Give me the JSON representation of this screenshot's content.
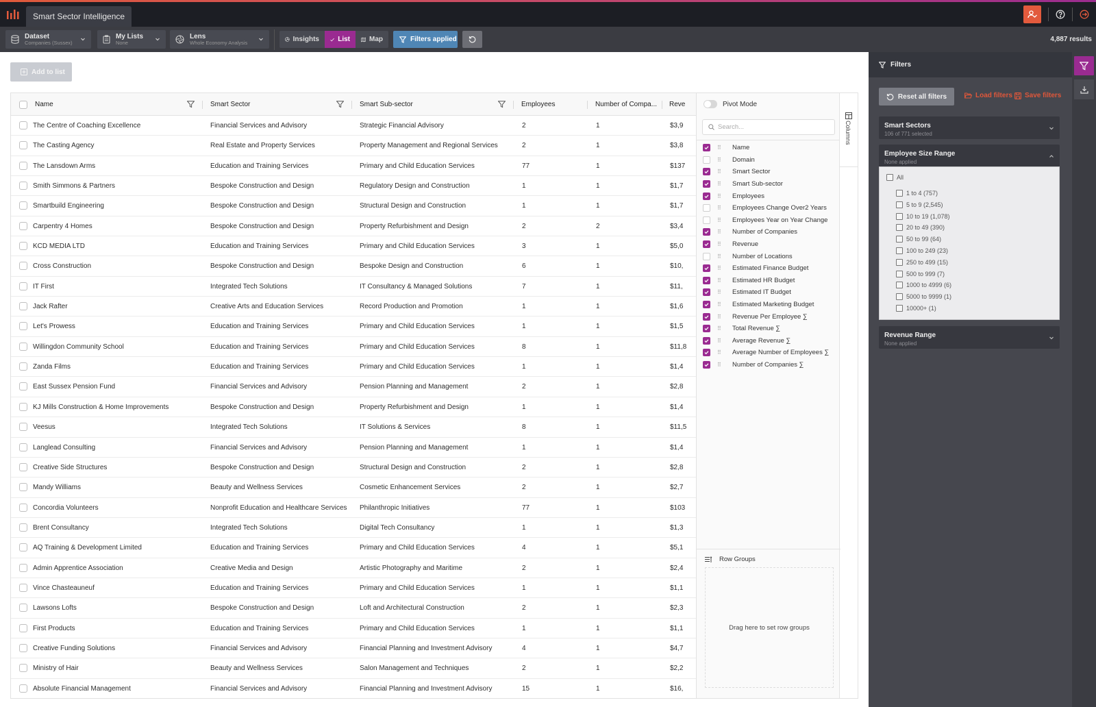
{
  "app": {
    "tab_title": "Smart Sector Intelligence",
    "colors": {
      "brand": "#e25a3d",
      "accent": "#9a2b91",
      "filters_blue": "#4f86b5"
    }
  },
  "toolbar": {
    "dataset": {
      "label": "Dataset",
      "value": "Companies (Sussex)",
      "icon": "database-icon"
    },
    "my_lists": {
      "label": "My Lists",
      "value": "None",
      "icon": "clipboard-icon"
    },
    "lens": {
      "label": "Lens",
      "value": "Whole Economy Analysis",
      "icon": "aperture-icon"
    },
    "views": [
      {
        "label": "Insights",
        "icon": "insights-icon",
        "active": false
      },
      {
        "label": "List",
        "icon": "check-icon",
        "active": true
      },
      {
        "label": "Map",
        "icon": "map-icon",
        "active": false
      }
    ],
    "filters_applied_label": "Filters applied",
    "results": "4,887 results"
  },
  "main": {
    "add_to_list_label": "Add to list",
    "columns": [
      "Name",
      "Smart Sector",
      "Smart Sub-sector",
      "Employees",
      "Number of Compa...",
      "Reve"
    ],
    "rows": [
      {
        "name": "The Centre of Coaching Excellence",
        "sector": "Financial Services and Advisory",
        "subsector": "Strategic Financial Advisory",
        "employees": "2",
        "companies": "1",
        "revenue": "$3,9"
      },
      {
        "name": "The Casting Agency",
        "sector": "Real Estate and Property Services",
        "subsector": "Property Management and Regional Services",
        "employees": "2",
        "companies": "1",
        "revenue": "$3,8"
      },
      {
        "name": "The Lansdown Arms",
        "sector": "Education and Training Services",
        "subsector": "Primary and Child Education Services",
        "employees": "77",
        "companies": "1",
        "revenue": "$137"
      },
      {
        "name": "Smith Simmons & Partners",
        "sector": "Bespoke Construction and Design",
        "subsector": "Regulatory Design and Construction",
        "employees": "1",
        "companies": "1",
        "revenue": "$1,7"
      },
      {
        "name": "Smartbuild Engineering",
        "sector": "Bespoke Construction and Design",
        "subsector": "Structural Design and Construction",
        "employees": "1",
        "companies": "1",
        "revenue": "$1,7"
      },
      {
        "name": "Carpentry 4 Homes",
        "sector": "Bespoke Construction and Design",
        "subsector": "Property Refurbishment and Design",
        "employees": "2",
        "companies": "2",
        "revenue": "$3,4"
      },
      {
        "name": "KCD MEDIA LTD",
        "sector": "Education and Training Services",
        "subsector": "Primary and Child Education Services",
        "employees": "3",
        "companies": "1",
        "revenue": "$5,0"
      },
      {
        "name": "Cross Construction",
        "sector": "Bespoke Construction and Design",
        "subsector": "Bespoke Design and Construction",
        "employees": "6",
        "companies": "1",
        "revenue": "$10,"
      },
      {
        "name": "IT First",
        "sector": "Integrated Tech Solutions",
        "subsector": "IT Consultancy & Managed Solutions",
        "employees": "7",
        "companies": "1",
        "revenue": "$11,"
      },
      {
        "name": "Jack Rafter",
        "sector": "Creative Arts and Education Services",
        "subsector": "Record Production and Promotion",
        "employees": "1",
        "companies": "1",
        "revenue": "$1,6"
      },
      {
        "name": "Let's Prowess",
        "sector": "Education and Training Services",
        "subsector": "Primary and Child Education Services",
        "employees": "1",
        "companies": "1",
        "revenue": "$1,5"
      },
      {
        "name": "Willingdon Community School",
        "sector": "Education and Training Services",
        "subsector": "Primary and Child Education Services",
        "employees": "8",
        "companies": "1",
        "revenue": "$11,8"
      },
      {
        "name": "Zanda Films",
        "sector": "Education and Training Services",
        "subsector": "Primary and Child Education Services",
        "employees": "1",
        "companies": "1",
        "revenue": "$1,4"
      },
      {
        "name": "East Sussex Pension Fund",
        "sector": "Financial Services and Advisory",
        "subsector": "Pension Planning and Management",
        "employees": "2",
        "companies": "1",
        "revenue": "$2,8"
      },
      {
        "name": "KJ Mills Construction & Home Improvements",
        "sector": "Bespoke Construction and Design",
        "subsector": "Property Refurbishment and Design",
        "employees": "1",
        "companies": "1",
        "revenue": "$1,4"
      },
      {
        "name": "Veesus",
        "sector": "Integrated Tech Solutions",
        "subsector": "IT Solutions & Services",
        "employees": "8",
        "companies": "1",
        "revenue": "$11,5"
      },
      {
        "name": "Langlead Consulting",
        "sector": "Financial Services and Advisory",
        "subsector": "Pension Planning and Management",
        "employees": "1",
        "companies": "1",
        "revenue": "$1,4"
      },
      {
        "name": "Creative Side Structures",
        "sector": "Bespoke Construction and Design",
        "subsector": "Structural Design and Construction",
        "employees": "2",
        "companies": "1",
        "revenue": "$2,8"
      },
      {
        "name": "Mandy Williams",
        "sector": "Beauty and Wellness Services",
        "subsector": "Cosmetic Enhancement Services",
        "employees": "2",
        "companies": "1",
        "revenue": "$2,7"
      },
      {
        "name": "Concordia Volunteers",
        "sector": "Nonprofit Education and Healthcare Services",
        "subsector": "Philanthropic Initiatives",
        "employees": "77",
        "companies": "1",
        "revenue": "$103"
      },
      {
        "name": "Brent Consultancy",
        "sector": "Integrated Tech Solutions",
        "subsector": "Digital Tech Consultancy",
        "employees": "1",
        "companies": "1",
        "revenue": "$1,3"
      },
      {
        "name": "AQ Training & Development Limited",
        "sector": "Education and Training Services",
        "subsector": "Primary and Child Education Services",
        "employees": "4",
        "companies": "1",
        "revenue": "$5,1"
      },
      {
        "name": "Admin Apprentice Association",
        "sector": "Creative Media and Design",
        "subsector": "Artistic Photography and Maritime",
        "employees": "2",
        "companies": "1",
        "revenue": "$2,4"
      },
      {
        "name": "Vince Chasteauneuf",
        "sector": "Education and Training Services",
        "subsector": "Primary and Child Education Services",
        "employees": "1",
        "companies": "1",
        "revenue": "$1,1"
      },
      {
        "name": "Lawsons Lofts",
        "sector": "Bespoke Construction and Design",
        "subsector": "Loft and Architectural Construction",
        "employees": "2",
        "companies": "1",
        "revenue": "$2,3"
      },
      {
        "name": "First Products",
        "sector": "Education and Training Services",
        "subsector": "Primary and Child Education Services",
        "employees": "1",
        "companies": "1",
        "revenue": "$1,1"
      },
      {
        "name": "Creative Funding Solutions",
        "sector": "Financial Services and Advisory",
        "subsector": "Financial Planning and Investment Advisory",
        "employees": "4",
        "companies": "1",
        "revenue": "$4,7"
      },
      {
        "name": "Ministry of Hair",
        "sector": "Beauty and Wellness Services",
        "subsector": "Salon Management and Techniques",
        "employees": "2",
        "companies": "1",
        "revenue": "$2,2"
      },
      {
        "name": "Absolute Financial Management",
        "sector": "Financial Services and Advisory",
        "subsector": "Financial Planning and Investment Advisory",
        "employees": "15",
        "companies": "1",
        "revenue": "$16,"
      }
    ]
  },
  "columns_panel": {
    "pivot_mode_label": "Pivot Mode",
    "pivot_mode_on": false,
    "search_placeholder": "Search...",
    "side_tab_label": "Columns",
    "items": [
      {
        "label": "Name",
        "checked": true
      },
      {
        "label": "Domain",
        "checked": false
      },
      {
        "label": "Smart Sector",
        "checked": true
      },
      {
        "label": "Smart Sub-sector",
        "checked": true
      },
      {
        "label": "Employees",
        "checked": true
      },
      {
        "label": "Employees Change Over2 Years",
        "checked": false
      },
      {
        "label": "Employees Year on Year Change",
        "checked": false
      },
      {
        "label": "Number of Companies",
        "checked": true
      },
      {
        "label": "Revenue",
        "checked": true
      },
      {
        "label": "Number of Locations",
        "checked": false
      },
      {
        "label": "Estimated Finance Budget",
        "checked": true
      },
      {
        "label": "Estimated HR Budget",
        "checked": true
      },
      {
        "label": "Estimated IT Budget",
        "checked": true
      },
      {
        "label": "Estimated Marketing Budget",
        "checked": true
      },
      {
        "label": "Revenue Per Employee ∑",
        "checked": true
      },
      {
        "label": "Total Revenue ∑",
        "checked": true
      },
      {
        "label": "Average Revenue ∑",
        "checked": true
      },
      {
        "label": "Average Number of Employees ∑",
        "checked": true
      },
      {
        "label": "Number of Companies ∑",
        "checked": true
      }
    ],
    "row_groups_label": "Row Groups",
    "row_groups_drop": "Drag here to set row groups"
  },
  "filters": {
    "title": "Filters",
    "reset_all": "Reset all filters",
    "load": "Load filters",
    "save": "Save filters",
    "smart_sectors": {
      "title": "Smart Sectors",
      "subtitle": "106 of 771 selected"
    },
    "employee_size": {
      "title": "Employee Size Range",
      "subtitle": "None applied",
      "all_label": "All",
      "options": [
        "1 to 4 (757)",
        "5 to 9 (2,545)",
        "10 to 19 (1,078)",
        "20 to 49 (390)",
        "50 to 99 (64)",
        "100 to 249 (23)",
        "250 to 499 (15)",
        "500 to 999 (7)",
        "1000 to 4999 (6)",
        "5000 to 9999 (1)",
        "10000+ (1)"
      ]
    },
    "revenue_range": {
      "title": "Revenue Range",
      "subtitle": "None applied"
    }
  }
}
